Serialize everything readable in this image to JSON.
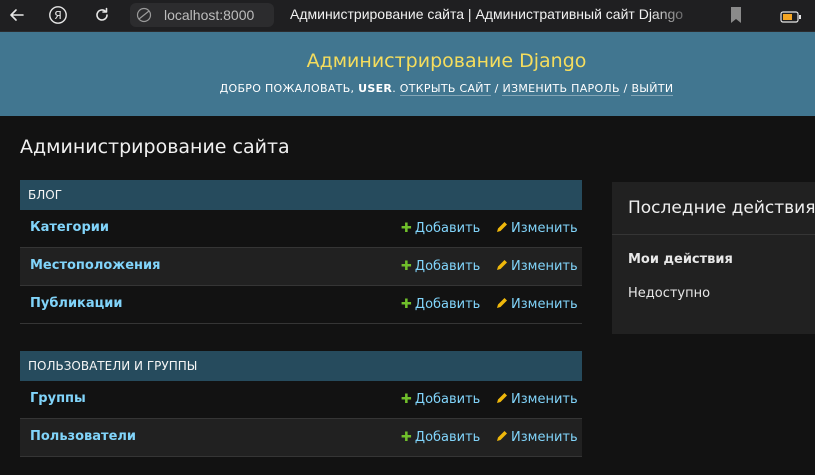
{
  "browser": {
    "address": "localhost:8000",
    "tab_title": "Администрирование сайта | Административный сайт Django"
  },
  "header": {
    "site_name": "Администрирование Django",
    "welcome": "ДОБРО ПОЖАЛОВАТЬ,",
    "username": "USER",
    "view_site": "ОТКРЫТЬ САЙТ",
    "change_password": "ИЗМЕНИТЬ ПАРОЛЬ",
    "logout": "ВЫЙТИ",
    "separator": "/"
  },
  "content": {
    "title": "Администрирование сайта"
  },
  "modules": [
    {
      "caption": "БЛОГ",
      "rows": [
        {
          "name": "Категории",
          "add": "Добавить",
          "change": "Изменить"
        },
        {
          "name": "Местоположения",
          "add": "Добавить",
          "change": "Изменить"
        },
        {
          "name": "Публикации",
          "add": "Добавить",
          "change": "Изменить"
        }
      ]
    },
    {
      "caption": "ПОЛЬЗОВАТЕЛИ И ГРУППЫ",
      "rows": [
        {
          "name": "Группы",
          "add": "Добавить",
          "change": "Изменить"
        },
        {
          "name": "Пользователи",
          "add": "Добавить",
          "change": "Изменить"
        }
      ]
    }
  ],
  "recent_actions": {
    "title": "Последние действия",
    "subtitle": "Мои действия",
    "empty": "Недоступно"
  },
  "colors": {
    "header_bg": "#417690",
    "site_name": "#f5dd5d",
    "caption_bg": "#264b5d",
    "link": "#81d4fa",
    "add_icon": "#70bf2b",
    "change_icon": "#efb80b"
  }
}
